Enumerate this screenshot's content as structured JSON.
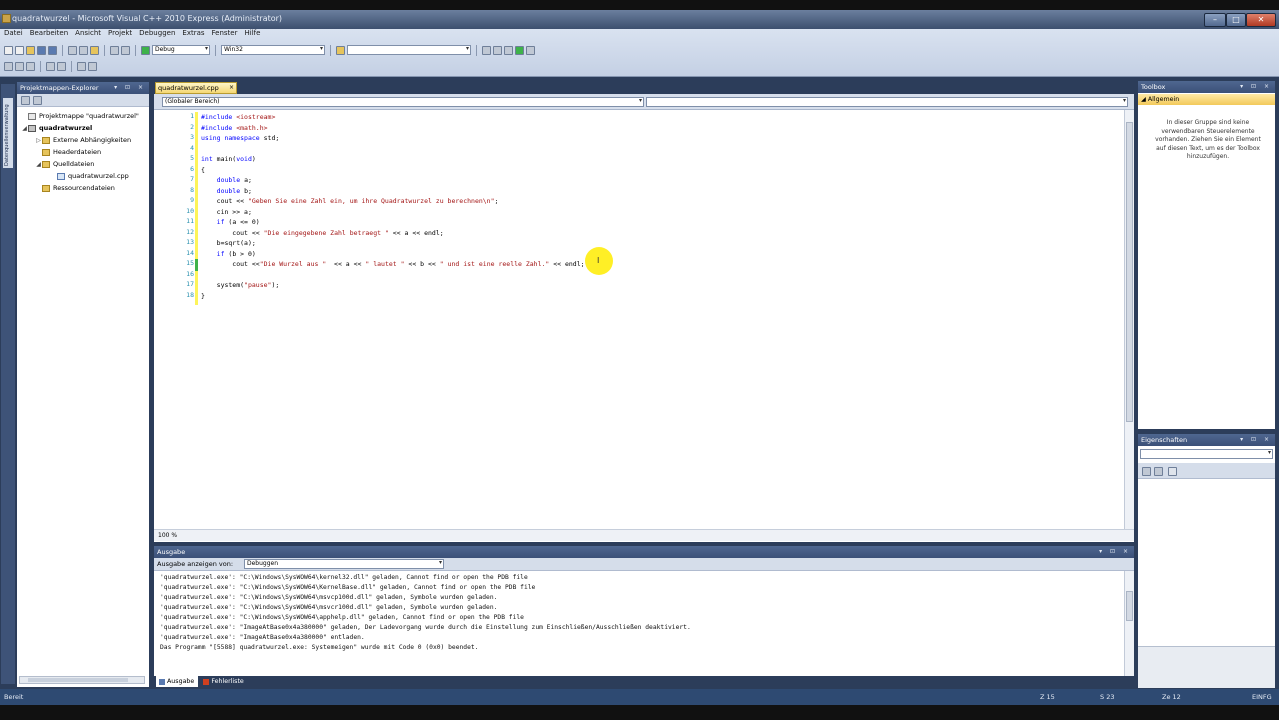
{
  "window": {
    "title": "quadratwurzel - Microsoft Visual C++ 2010 Express (Administrator)"
  },
  "menu": [
    "Datei",
    "Bearbeiten",
    "Ansicht",
    "Projekt",
    "Debuggen",
    "Extras",
    "Fenster",
    "Hilfe"
  ],
  "toolbar": {
    "config": "Debug",
    "platform": "Win32",
    "search_value": ""
  },
  "left_tab": {
    "label": "Datenquellenverwaltung"
  },
  "solution_explorer": {
    "title": "Projektmappen-Explorer",
    "buttons": "▾ ⊡ ×",
    "items": [
      {
        "label": "Projektmappe \"quadratwurzel\"",
        "icon": "solution-icon"
      },
      {
        "label": "quadratwurzel",
        "icon": "project-icon"
      },
      {
        "label": "Externe Abhängigkeiten",
        "icon": "folder-icon"
      },
      {
        "label": "Headerdateien",
        "icon": "folder-icon"
      },
      {
        "label": "Quelldateien",
        "icon": "folder-icon"
      },
      {
        "label": "quadratwurzel.cpp",
        "icon": "cpp-file-icon"
      },
      {
        "label": "Ressourcendateien",
        "icon": "folder-icon"
      }
    ]
  },
  "editor": {
    "tab_label": "quadratwurzel.cpp",
    "tab_close": "×",
    "scope": "(Globaler Bereich)",
    "member": "",
    "zoom": "100 %",
    "line_numbers": [
      "1",
      "2",
      "3",
      "4",
      "5",
      "6",
      "7",
      "8",
      "9",
      "10",
      "11",
      "12",
      "13",
      "14",
      "15",
      "16",
      "17",
      "18"
    ],
    "lines": [
      [
        [
          "pp",
          "#include "
        ],
        [
          "inc",
          "<iostream>"
        ]
      ],
      [
        [
          "pp",
          "#include "
        ],
        [
          "inc",
          "<math.h>"
        ]
      ],
      [
        [
          "kw",
          "using namespace "
        ],
        [
          "",
          "std;"
        ]
      ],
      [
        [
          "",
          ""
        ]
      ],
      [
        [
          "kw",
          "int "
        ],
        [
          "",
          "main("
        ],
        [
          "kw",
          "void"
        ],
        [
          "",
          ")"
        ]
      ],
      [
        [
          "",
          "{"
        ]
      ],
      [
        [
          "",
          "    "
        ],
        [
          "kw",
          "double "
        ],
        [
          "",
          "a;"
        ]
      ],
      [
        [
          "",
          "    "
        ],
        [
          "kw",
          "double "
        ],
        [
          "",
          "b;"
        ]
      ],
      [
        [
          "",
          "    cout << "
        ],
        [
          "str",
          "\"Geben Sie eine Zahl ein, um ihre Quadratwurzel zu berechnen\\n\""
        ],
        [
          "",
          ";"
        ]
      ],
      [
        [
          "",
          "    cin >> a;"
        ]
      ],
      [
        [
          "",
          "    "
        ],
        [
          "kw",
          "if "
        ],
        [
          "",
          "(a <= 0)"
        ]
      ],
      [
        [
          "",
          "        cout << "
        ],
        [
          "str",
          "\"Die eingegebene Zahl betraegt \""
        ],
        [
          "",
          " << a << endl;"
        ]
      ],
      [
        [
          "",
          "    b=sqrt(a);"
        ]
      ],
      [
        [
          "",
          "    "
        ],
        [
          "kw",
          "if "
        ],
        [
          "",
          "(b > 0)"
        ]
      ],
      [
        [
          "",
          "        cout <<"
        ],
        [
          "str",
          "\"Die Wurzel aus \""
        ],
        [
          "",
          "  << a << "
        ],
        [
          "str",
          "\" lautet \""
        ],
        [
          "",
          " << b << "
        ],
        [
          "str",
          "\" und ist eine reelle Zahl.\""
        ],
        [
          "",
          " << endl;"
        ]
      ],
      [
        [
          "",
          ""
        ]
      ],
      [
        [
          "",
          "    system("
        ],
        [
          "str",
          "\"pause\""
        ],
        [
          "",
          ");"
        ]
      ],
      [
        [
          "",
          "}"
        ]
      ]
    ]
  },
  "output": {
    "title": "Ausgabe",
    "buttons": "▾ ⊡ ×",
    "show_label": "Ausgabe anzeigen von:",
    "source": "Debuggen",
    "lines": [
      "'quadratwurzel.exe': \"C:\\Windows\\SysWOW64\\kernel32.dll\" geladen, Cannot find or open the PDB file",
      "'quadratwurzel.exe': \"C:\\Windows\\SysWOW64\\KernelBase.dll\" geladen, Cannot find or open the PDB file",
      "'quadratwurzel.exe': \"C:\\Windows\\SysWOW64\\msvcp100d.dll\" geladen, Symbole wurden geladen.",
      "'quadratwurzel.exe': \"C:\\Windows\\SysWOW64\\msvcr100d.dll\" geladen, Symbole wurden geladen.",
      "'quadratwurzel.exe': \"C:\\Windows\\SysWOW64\\apphelp.dll\" geladen, Cannot find or open the PDB file",
      "'quadratwurzel.exe': \"ImageAtBase0x4a380000\" geladen, Der Ladevorgang wurde durch die Einstellung zum Einschließen/Ausschließen deaktiviert.",
      "'quadratwurzel.exe': \"ImageAtBase0x4a380000\" entladen.",
      "Das Programm \"[5588] quadratwurzel.exe: Systemeigen\" wurde mit Code 0 (0x0) beendet."
    ],
    "tabs": [
      "Ausgabe",
      "Fehlerliste"
    ]
  },
  "toolbox": {
    "title": "Toolbox",
    "buttons": "▾ ⊡ ×",
    "group": "◢ Allgemein",
    "message": "In dieser Gruppe sind keine verwendbaren Steuerelemente vorhanden. Ziehen Sie ein Element auf diesen Text, um es der Toolbox hinzuzufügen."
  },
  "properties": {
    "title": "Eigenschaften",
    "buttons": "▾ ⊡ ×",
    "object": ""
  },
  "status": {
    "left": "Bereit",
    "line": "Z 15",
    "col": "S 23",
    "char": "Ze 12",
    "mode": "EINFG"
  },
  "colors": {
    "accent": "#2c3d5a",
    "tab_active": "#f4d774",
    "cursor_highlight": "#ffec00",
    "keyword": "#0000ff",
    "string": "#a31515",
    "line_number": "#2b91af"
  }
}
